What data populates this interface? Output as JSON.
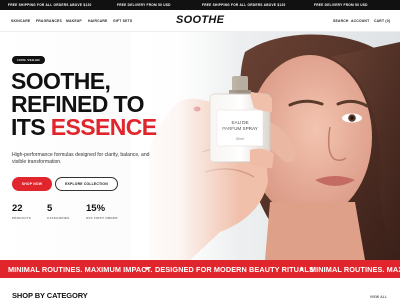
{
  "announcement": {
    "messages": [
      "FREE SHIPPING FOR ALL ORDERS ABOVE $120",
      "FREE DELIVERY FROM 50 USD",
      "FREE SHIPPING FOR ALL ORDERS ABOVE $120",
      "FREE DELIVERY FROM 50 USD"
    ]
  },
  "header": {
    "nav": [
      "SKINCARE",
      "FRAGRANCES",
      "MAKEUP",
      "HAIRCARE",
      "GIFT SETS"
    ],
    "logo": "SOOTHE",
    "right_nav": [
      "SEARCH",
      "ACCOUNT",
      "CART (0)"
    ]
  },
  "hero": {
    "badge": "100% VEGAN",
    "headline_1": "SOOTHE,",
    "headline_2": "REFINED TO",
    "headline_3_prefix": "ITS ",
    "headline_3_accent": "ESSENCE",
    "description": "High-performance formulas designed for clarity, balance, and visible transformation.",
    "primary_button": "SHOP NOW",
    "secondary_button": "EXPLORE COLLECTION",
    "stats": [
      {
        "value": "22",
        "label": "PRODUCTS"
      },
      {
        "value": "5",
        "label": "CATEGORIES"
      },
      {
        "value": "15%",
        "label": "OFF FIRST ORDER"
      }
    ],
    "bottle_label_1": "EAU DE",
    "bottle_label_2": "PARFUM SPRAY",
    "bottle_volume": "50 ml"
  },
  "marquee": {
    "items": [
      "MINIMAL ROUTINES. MAXIMUM IMPACT.",
      "DESIGNED FOR MODERN BEAUTY RITUALS.",
      "MINIMAL ROUTINES. MAXIMUM IMPACT."
    ]
  },
  "category": {
    "title": "SHOP BY CATEGORY",
    "view_all": "VIEW ALL"
  },
  "colors": {
    "accent": "#e0262c",
    "dark": "#111111"
  }
}
